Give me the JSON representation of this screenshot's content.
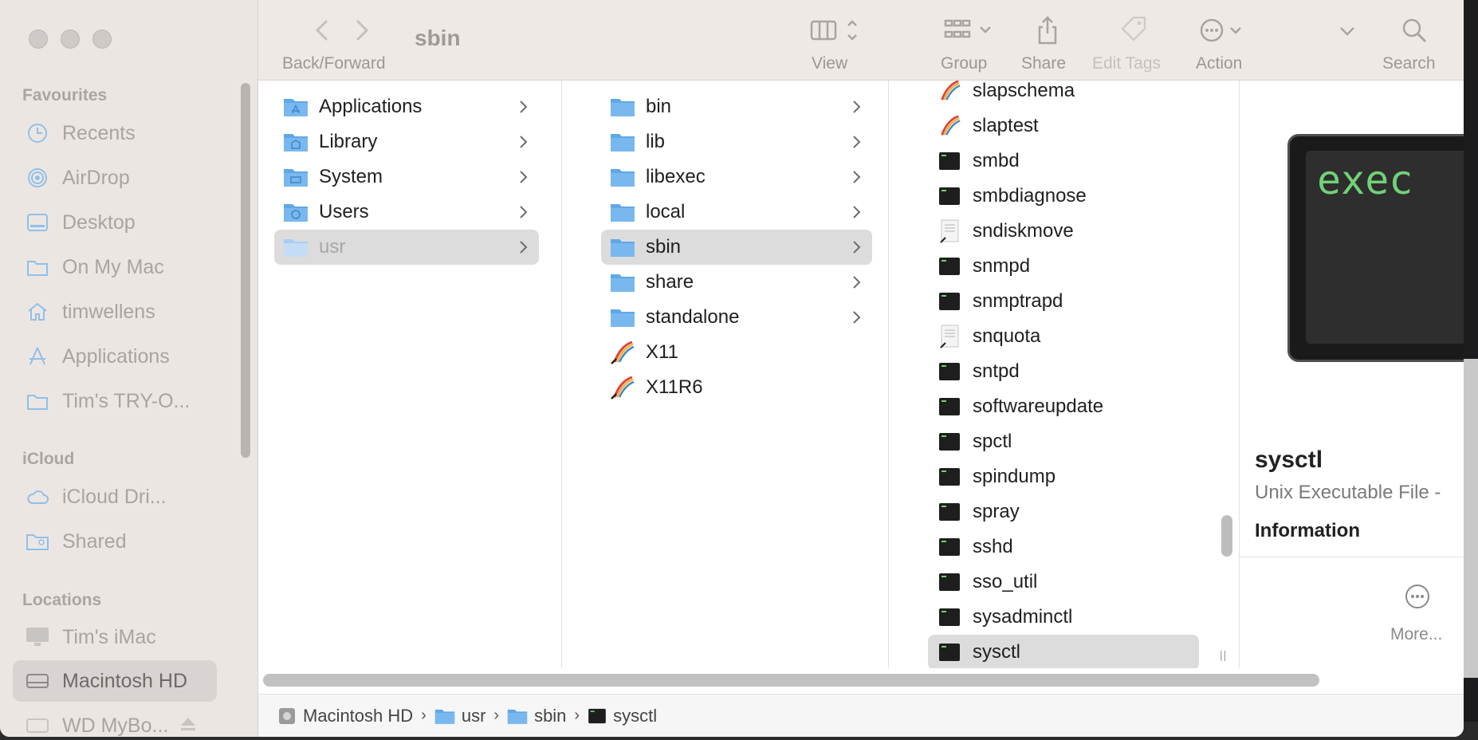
{
  "window": {
    "title": "sbin"
  },
  "toolbar": {
    "nav_label": "Back/Forward",
    "view_label": "View",
    "group_label": "Group",
    "share_label": "Share",
    "tags_label": "Edit Tags",
    "action_label": "Action",
    "search_label": "Search"
  },
  "sidebar": {
    "favourites_header": "Favourites",
    "favourites": [
      {
        "label": "Recents",
        "icon": "clock-icon"
      },
      {
        "label": "AirDrop",
        "icon": "airdrop-icon"
      },
      {
        "label": "Desktop",
        "icon": "desktop-icon"
      },
      {
        "label": "On My Mac",
        "icon": "folder-icon"
      },
      {
        "label": "timwellens",
        "icon": "home-icon"
      },
      {
        "label": "Applications",
        "icon": "applications-icon"
      },
      {
        "label": "Tim's TRY-O...",
        "icon": "folder-icon"
      }
    ],
    "icloud_header": "iCloud",
    "icloud": [
      {
        "label": "iCloud Dri...",
        "icon": "cloud-icon"
      },
      {
        "label": "Shared",
        "icon": "shared-folder-icon"
      }
    ],
    "locations_header": "Locations",
    "locations": [
      {
        "label": "Tim's iMac",
        "icon": "imac-icon"
      },
      {
        "label": "Macintosh HD",
        "icon": "disk-icon"
      },
      {
        "label": "WD MyBo...",
        "icon": "external-disk-icon"
      }
    ]
  },
  "columns": {
    "col1": [
      "Applications",
      "Library",
      "System",
      "Users",
      "usr"
    ],
    "col2": [
      "bin",
      "lib",
      "libexec",
      "local",
      "sbin",
      "share",
      "standalone",
      "X11",
      "X11R6"
    ],
    "col3": [
      "slapschema",
      "slaptest",
      "smbd",
      "smbdiagnose",
      "sndiskmove",
      "snmpd",
      "snmptrapd",
      "snquota",
      "sntpd",
      "softwareupdate",
      "spctl",
      "spindump",
      "spray",
      "sshd",
      "sso_util",
      "sysadminctl",
      "sysctl"
    ]
  },
  "preview": {
    "thumb_text": "exec",
    "name": "sysctl",
    "kind": "Unix Executable File -",
    "info_header": "Information",
    "more_label": "More..."
  },
  "pathbar": [
    "Macintosh HD",
    "usr",
    "sbin",
    "sysctl"
  ],
  "colors": {
    "folder": "#5fa8e6",
    "terminal_text": "#71d178",
    "selection": "#dcdcdc"
  }
}
